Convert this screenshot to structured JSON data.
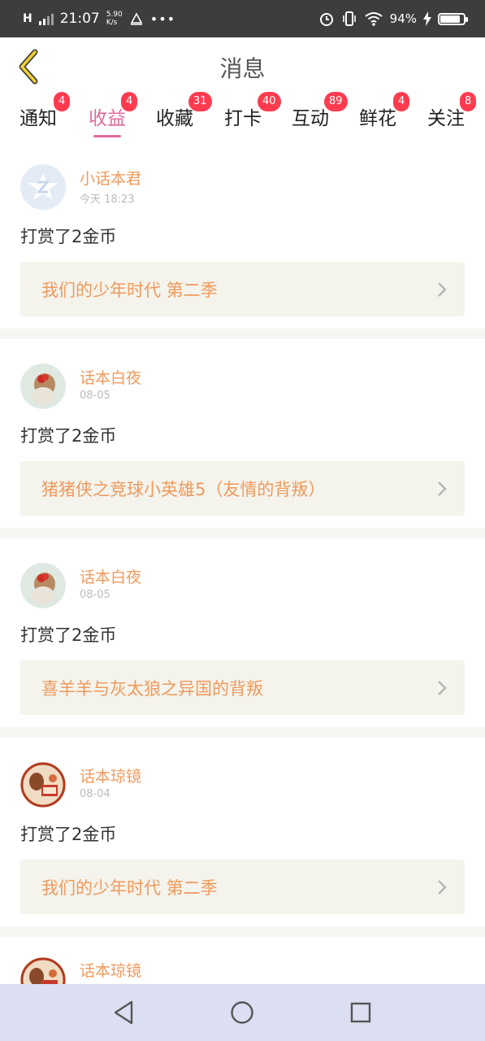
{
  "status_bar": {
    "network": "H",
    "time": "21:07",
    "speed_value": "5.90",
    "speed_unit": "K/s",
    "battery": "94%",
    "battery_level": 0.94
  },
  "header": {
    "title": "消息",
    "back_icon": "chevron-left-icon"
  },
  "tabs": [
    {
      "label": "通知",
      "badge": "4",
      "active": false
    },
    {
      "label": "收益",
      "badge": "4",
      "active": true
    },
    {
      "label": "收藏",
      "badge": "31",
      "active": false
    },
    {
      "label": "打卡",
      "badge": "40",
      "active": false
    },
    {
      "label": "互动",
      "badge": "89",
      "active": false
    },
    {
      "label": "鲜花",
      "badge": "4",
      "active": false
    },
    {
      "label": "关注",
      "badge": "8",
      "active": false
    }
  ],
  "feed": [
    {
      "user": "小话本君",
      "time": "今天 18:23",
      "action": "打赏了2金币",
      "book": "我们的少年时代 第二季",
      "avatar": "app-logo-avatar"
    },
    {
      "user": "话本白夜",
      "time": "08-05",
      "action": "打赏了2金币",
      "book": "猪猪侠之竞球小英雄5（友情的背叛）",
      "avatar": "girl-photo-avatar"
    },
    {
      "user": "话本白夜",
      "time": "08-05",
      "action": "打赏了2金币",
      "book": "喜羊羊与灰太狼之异国的背叛",
      "avatar": "girl-photo-avatar"
    },
    {
      "user": "话本琼镜",
      "time": "08-04",
      "action": "打赏了2金币",
      "book": "我们的少年时代 第二季",
      "avatar": "illustrated-avatar"
    }
  ],
  "partial_item": {
    "user": "话本琼镜"
  },
  "colors": {
    "accent_pink": "#e06a9e",
    "username_orange": "#ef9a5c",
    "badge_red": "#ff3b4f",
    "book_bg": "#f4f3ec",
    "nav_bg": "#dcdff2"
  },
  "nav_bar": {
    "back_icon": "triangle-back-icon",
    "home_icon": "circle-home-icon",
    "recents_icon": "square-recents-icon"
  }
}
